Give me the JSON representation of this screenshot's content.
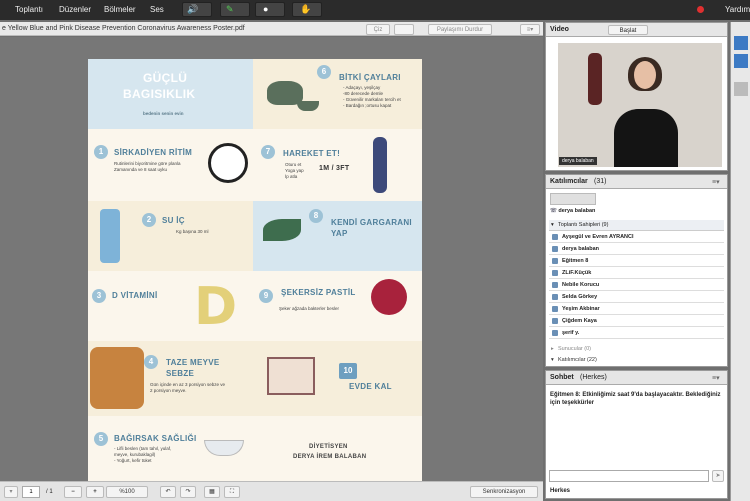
{
  "menu": [
    "Toplantı",
    "Düzenler",
    "Bölmeler",
    "Ses"
  ],
  "help_label": "Yardım",
  "doc": {
    "title": "e Yellow Blue and Pink Disease Prevention Coronavirus Awareness Poster.pdf",
    "draw_label": "Çiz",
    "stop_share_label": "Paylaşımı Durdur"
  },
  "poster": {
    "title1": "GÜÇLÜ",
    "title2": "BAGISIKLIK",
    "subtitle": "bedenin senin evin",
    "n6": "6",
    "h6": "BİTKİ ÇAYLARI",
    "t6": [
      "- Adaçayı, yeşilçay",
      "-80 derecede demle",
      "- Güvenilir markaları tercih et",
      "- Bardağın ;ortusu kapat"
    ],
    "n1": "1",
    "h1": "SİRKADİYEN RİTİM",
    "t1": [
      "Rutinlerini biyoritmine göre planla",
      "Zamanında ve 8 saat uyku"
    ],
    "n7": "7",
    "h7": "HAREKET ET!",
    "t7": [
      "Oturu et",
      "Yoga yap",
      "İp atla"
    ],
    "t7b": "1M / 3FT",
    "n2": "2",
    "h2": "SU İÇ",
    "t2": "Kg başına 30 ml",
    "n8": "8",
    "h8a": "KENDİ GARGARANI",
    "h8b": "YAP",
    "n3": "3",
    "h3": "D VİTAMİNİ",
    "bigd": "D",
    "n9": "9",
    "h9": "ŞEKERSİZ PASTİL",
    "t9": "Şeker ağzada bakterler besler",
    "n4": "4",
    "h4a": "TAZE MEYVE",
    "h4b": "SEBZE",
    "t4": [
      "Gün içinde en az 3 porsiyon sebze ve",
      "2 porsiyon meyve."
    ],
    "n10": "10",
    "h10": "EVDE KAL",
    "n5": "5",
    "h5": "BAĞIRSAK SAĞLIĞI",
    "t5": [
      "- Lifli beslen (tam tahıl, yulaf,",
      "meyve, kurubaklagil)",
      "- Yoğurt, kefir tüket"
    ],
    "dyt1": "DİYETİSYEN",
    "dyt2": "DERYA İREM BALABAN"
  },
  "bottom": {
    "page": "1",
    "of": "/ 1",
    "zoom": "%100",
    "sync": "Senkronizasyon"
  },
  "video": {
    "title": "Video",
    "start": "Başlat",
    "name": "derya balaban"
  },
  "participants": {
    "title": "Katılımcılar",
    "count": "(31)",
    "self": "derya balaban",
    "hosts": "Toplantı Sahipleri (9)",
    "rows": [
      "Ayşegül ve Evren AYRANCI",
      "derya balaban",
      "Eğitmen 8",
      "ZLiF.Küçük",
      "Nebile Korucu",
      "Selda Görkey",
      "Yeşim Akbinar",
      "Çiğdem Kaya",
      "şerif y."
    ],
    "presenters": "Sunucular (0)",
    "attendees": "Katılımcılar (22)"
  },
  "chat": {
    "title": "Sohbet",
    "sub": "(Herkes)",
    "message": "Eğitmen 8: Etkinliğimiz saat 9'da başlayacaktır. Beklediğiniz için teşekkürler",
    "to": "Herkes"
  }
}
